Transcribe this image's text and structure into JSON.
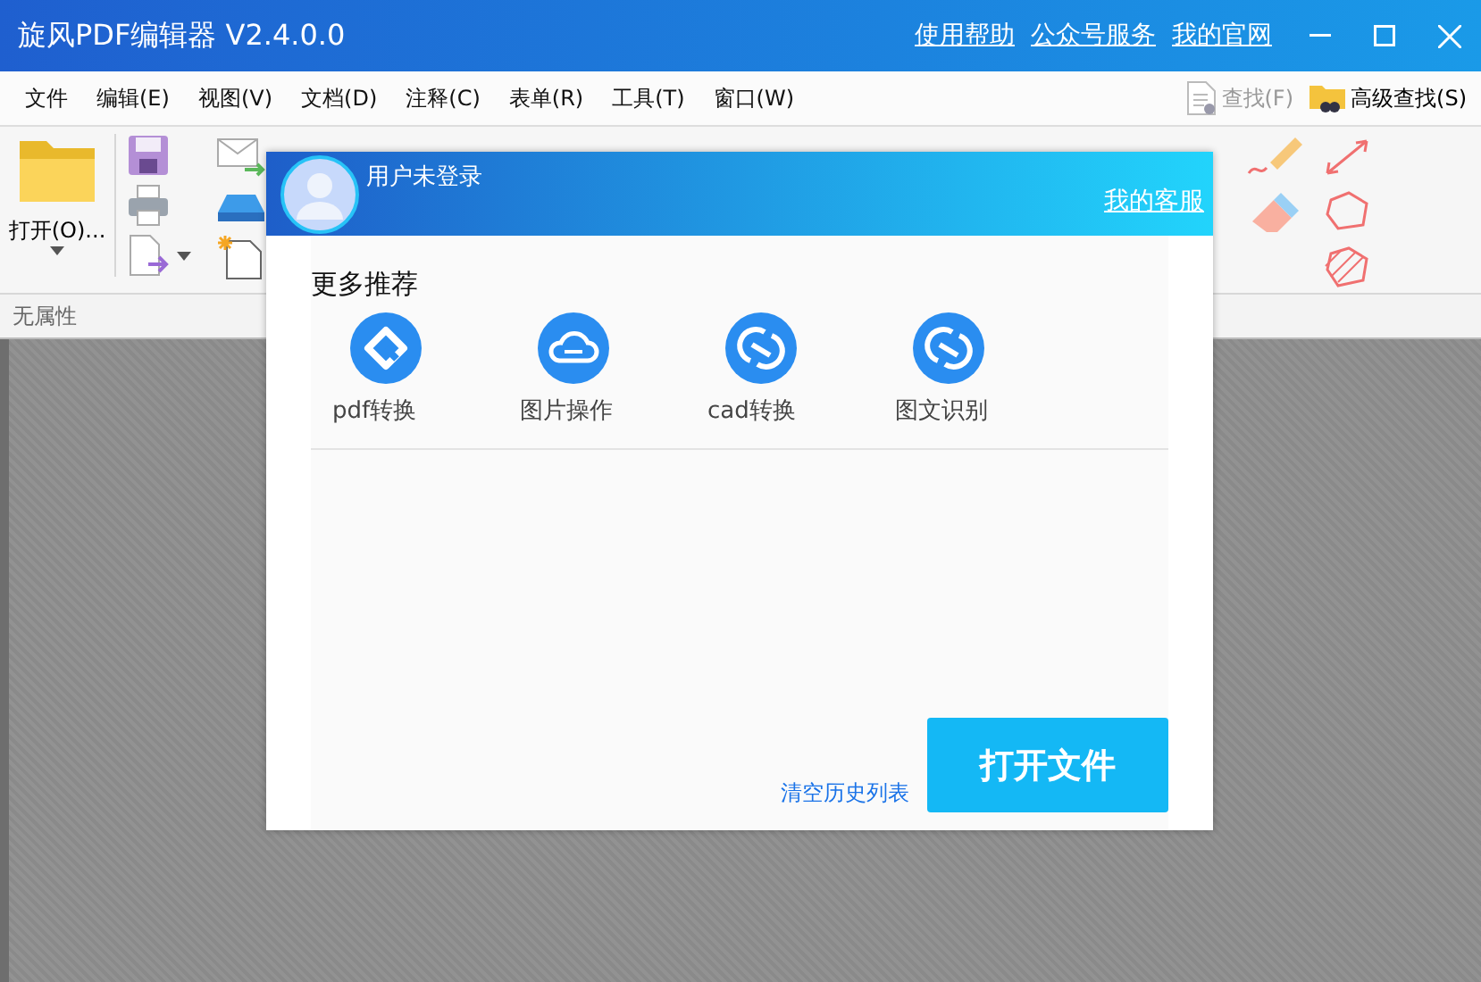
{
  "window": {
    "title": "旋风PDF编辑器 V2.4.0.0",
    "links": [
      "使用帮助",
      "公众号服务",
      "我的官网"
    ]
  },
  "menu": [
    "文件",
    "编辑(E)",
    "视图(V)",
    "文档(D)",
    "注释(C)",
    "表单(R)",
    "工具(T)",
    "窗口(W)"
  ],
  "search": [
    {
      "label": "查找(F)",
      "disabled": true
    },
    {
      "label": "高级查找(S)",
      "disabled": false
    }
  ],
  "ribbon": {
    "open_button": "打开(O)..."
  },
  "property_bar": "无属性",
  "dialog": {
    "user": "用户未登录",
    "service_link": "我的客服",
    "section_title": "更多推荐",
    "tools": [
      {
        "label": "pdf转换",
        "kind": "convert"
      },
      {
        "label": "图片操作",
        "kind": "cloud"
      },
      {
        "label": "cad转换",
        "kind": "swap"
      },
      {
        "label": "图文识别",
        "kind": "swap"
      }
    ],
    "clear_history": "清空历史列表",
    "open_file": "打开文件"
  }
}
